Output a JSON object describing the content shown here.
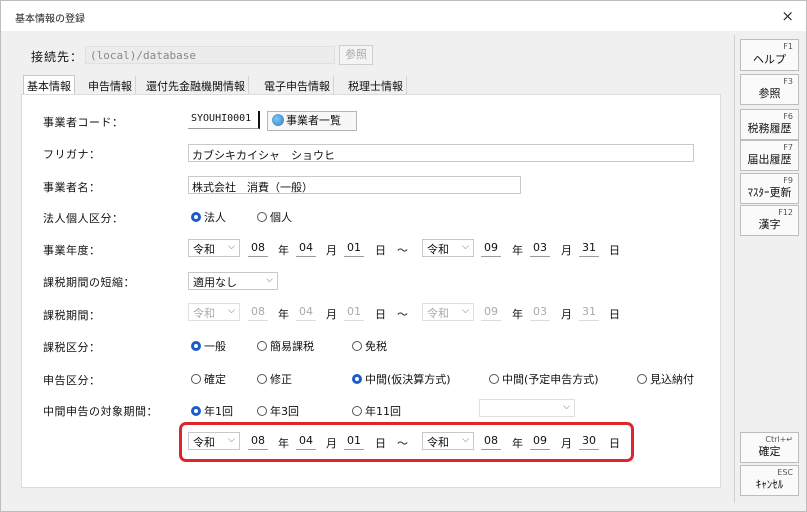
{
  "window": {
    "title": "基本情報の登録",
    "close": "×"
  },
  "connection": {
    "label": "接続先：",
    "value": "(local)/database",
    "ref_button": "参照"
  },
  "tabs": [
    {
      "label": "基本情報",
      "active": true
    },
    {
      "label": "申告情報",
      "active": false
    },
    {
      "label": "還付先金融機関情報",
      "active": false
    },
    {
      "label": "電子申告情報",
      "active": false
    },
    {
      "label": "税理士情報",
      "active": false
    }
  ],
  "form": {
    "code": {
      "label": "事業者コード：",
      "value": "SYOUHI0001",
      "list_button": "事業者一覧"
    },
    "furigana": {
      "label": "フリガナ：",
      "value": "カブシキカイシャ　ショウヒ"
    },
    "name": {
      "label": "事業者名：",
      "value": "株式会社　消費（一般）"
    },
    "entity": {
      "label": "法人個人区分：",
      "options": [
        "法人",
        "個人"
      ],
      "selected": "法人"
    },
    "fiscal_year": {
      "label": "事業年度：",
      "from": {
        "era": "令和",
        "y": "08",
        "m": "04",
        "d": "01"
      },
      "to": {
        "era": "令和",
        "y": "09",
        "m": "03",
        "d": "31"
      }
    },
    "shorten": {
      "label": "課税期間の短縮：",
      "value": "適用なし"
    },
    "tax_period": {
      "label": "課税期間：",
      "from": {
        "era": "令和",
        "y": "08",
        "m": "04",
        "d": "01"
      },
      "to": {
        "era": "令和",
        "y": "09",
        "m": "03",
        "d": "31"
      }
    },
    "tax_class": {
      "label": "課税区分：",
      "options": [
        "一般",
        "簡易課税",
        "免税"
      ],
      "selected": "一般"
    },
    "filing_class": {
      "label": "申告区分：",
      "options": [
        "確定",
        "修正",
        "中間(仮決算方式)",
        "中間(予定申告方式)",
        "見込納付"
      ],
      "selected": "中間(仮決算方式)"
    },
    "interim_period": {
      "label": "中間申告の対象期間：",
      "options": [
        "年1回",
        "年3回",
        "年11回"
      ],
      "selected": "年1回",
      "from": {
        "era": "令和",
        "y": "08",
        "m": "04",
        "d": "01"
      },
      "to": {
        "era": "令和",
        "y": "08",
        "m": "09",
        "d": "30"
      }
    },
    "units": {
      "year": "年",
      "month": "月",
      "day": "日",
      "tilde": "～"
    }
  },
  "fkeys": [
    {
      "key": "F1",
      "label": "ヘルプ"
    },
    {
      "key": "F3",
      "label": "参照"
    },
    {
      "key": "F6",
      "label": "税務履歴"
    },
    {
      "key": "F7",
      "label": "届出履歴"
    },
    {
      "key": "F9",
      "label": "ﾏｽﾀｰ更新"
    },
    {
      "key": "F12",
      "label": "漢字"
    },
    {
      "key": "Ctrl+↵",
      "label": "確定"
    },
    {
      "key": "ESC",
      "label": "ｷｬﾝｾﾙ"
    }
  ]
}
